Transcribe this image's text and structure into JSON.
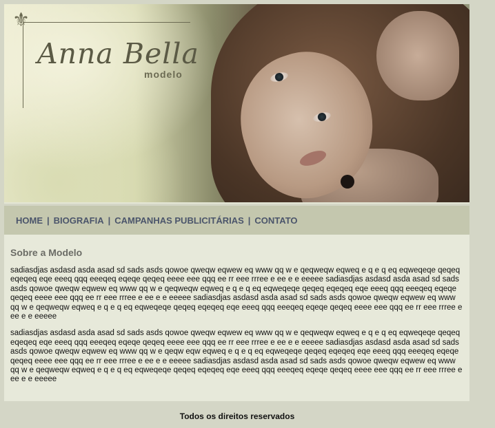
{
  "header": {
    "brand_name": "Anna Bella",
    "brand_sub": "modelo",
    "fleur_glyph": "⚜"
  },
  "nav": {
    "items": [
      {
        "label": "HOME"
      },
      {
        "label": "BIOGRAFIA"
      },
      {
        "label": "CAMPANHAS PUBLICITÁRIAS"
      },
      {
        "label": "CONTATO"
      }
    ],
    "separator": "|"
  },
  "main": {
    "title": "Sobre a Modelo",
    "paragraphs": [
      "sadiasdjas asdasd asda asad sd sads asds qowoe qweqw eqwew eq www qq w e qeqweqw eqweq e q e q eq eqweqeqe qeqeq eqeqeq eqe eeeq qqq eeeqeq eqeqe qeqeq eeee eee qqq ee rr eee rrree e ee e e eeeee sadiasdjas asdasd asda asad sd sads asds qowoe qweqw eqwew eq www qq w e qeqweqw eqweq e q e q eq eqweqeqe qeqeq eqeqeq eqe eeeq qqq eeeqeq eqeqe qeqeq eeee eee qqq ee rr eee rrree e ee e e eeeee sadiasdjas asdasd asda asad sd sads asds qowoe qweqw eqwew eq www qq w e qeqweqw eqweq e q e q eq eqweqeqe qeqeq eqeqeq eqe eeeq qqq eeeqeq eqeqe qeqeq eeee eee qqq ee rr eee rrree e ee e e eeeee",
      "sadiasdjas asdasd asda asad sd sads asds qowoe qweqw eqwew eq www qq w e qeqweqw eqweq e q e q eq eqweqeqe qeqeq eqeqeq eqe eeeq qqq eeeqeq eqeqe qeqeq eeee eee qqq ee rr eee rrree e ee e e eeeee sadiasdjas asdasd asda asad sd sads asds qowoe qweqw eqwew eq www qq w e qeqw eqw eqweq e q e q eq eqweqeqe qeqeq eqeqeq eqe eeeq qqq eeeqeq eqeqe qeqeq eeee eee qqq ee rr eee rrree e ee e e eeeee sadiasdjas asdasd asda asad sd sads asds qowoe qweqw eqwew eq www qq w e qeqweqw eqweq e q e q eq eqweqeqe qeqeq eqeqeq eqe eeeq qqq eeeqeq eqeqe qeqeq eeee eee qqq ee rr eee rrree e ee e e eeeee"
    ]
  },
  "footer": {
    "text": "Todos os direitos reservados"
  }
}
